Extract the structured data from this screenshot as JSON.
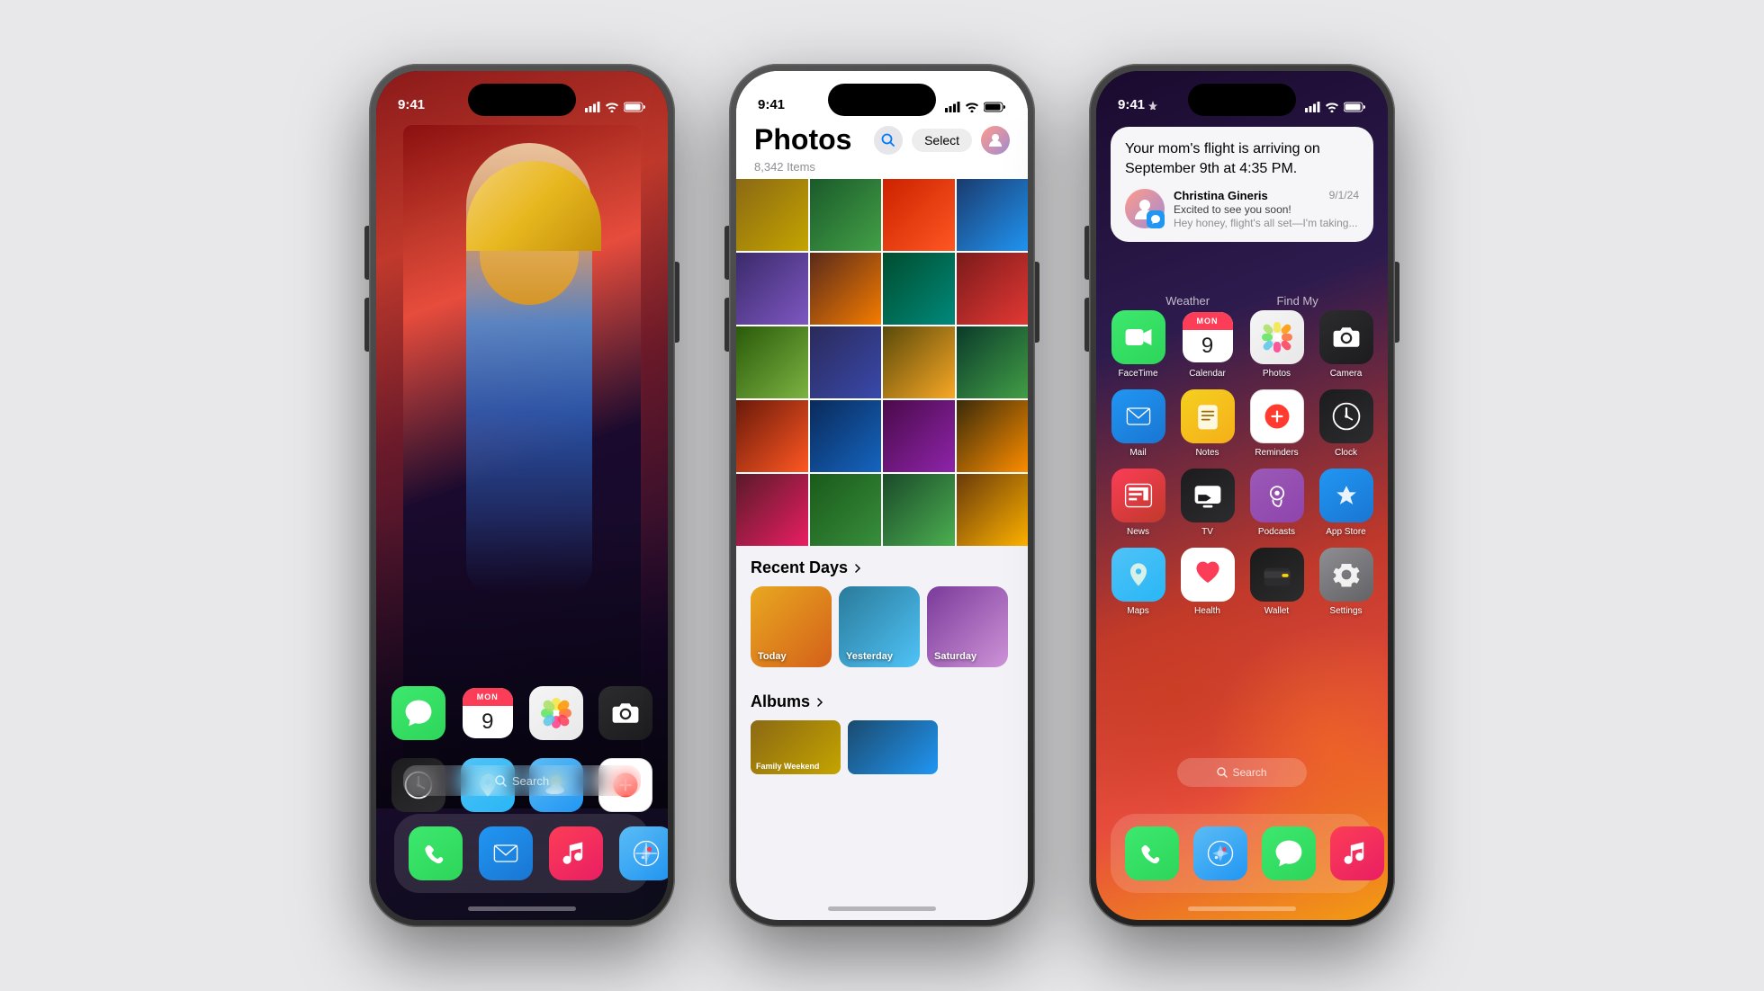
{
  "background": "#e8e8ea",
  "phones": [
    {
      "id": "phone1",
      "label": "iPhone Home Screen",
      "status_time": "9:41",
      "apps_main": [
        {
          "id": "messages",
          "label": "Messages",
          "color_class": "app-messages"
        },
        {
          "id": "calendar",
          "label": "Calendar",
          "color_class": "app-calendar"
        },
        {
          "id": "photos",
          "label": "Photos",
          "color_class": "app-photos"
        },
        {
          "id": "camera",
          "label": "Camera",
          "color_class": "app-camera"
        },
        {
          "id": "clock",
          "label": "Clock",
          "color_class": "app-clock"
        },
        {
          "id": "maps",
          "label": "Maps",
          "color_class": "app-maps"
        },
        {
          "id": "weather",
          "label": "Weather",
          "color_class": "app-weather"
        },
        {
          "id": "reminders",
          "label": "Reminders",
          "color_class": "app-reminders"
        }
      ],
      "dock": [
        {
          "id": "phone",
          "label": "Phone",
          "color_class": "app-phone"
        },
        {
          "id": "mail",
          "label": "Mail",
          "color_class": "app-mail"
        },
        {
          "id": "music",
          "label": "Music",
          "color_class": "app-music"
        },
        {
          "id": "safari",
          "label": "Safari",
          "color_class": "app-safari"
        }
      ],
      "search_placeholder": "Search",
      "calendar_day": "9",
      "calendar_month": "MON"
    },
    {
      "id": "phone2",
      "label": "Photos App",
      "status_time": "9:41",
      "app_title": "Photos",
      "items_count": "8,342 Items",
      "select_label": "Select",
      "recent_days_title": "Recent Days",
      "albums_title": "Albums",
      "days": [
        {
          "label": "Today",
          "color": "#e8a820"
        },
        {
          "label": "Yesterday",
          "color": "#2a6e8a"
        },
        {
          "label": "Saturday",
          "color": "#6a2a8a"
        }
      ]
    },
    {
      "id": "phone3",
      "label": "iPhone Home with Siri Notification",
      "status_time": "9:41",
      "notification": {
        "main_text": "Your mom's flight is arriving on September 9th at 4:35 PM.",
        "contact_name": "Christina Gineris",
        "contact_date": "9/1/24",
        "message_preview": "Excited to see you soon!",
        "message_sub": "Hey honey, flight's all set—I'm taking..."
      },
      "widget_labels": [
        "Weather",
        "Find My"
      ],
      "apps": [
        {
          "id": "facetime",
          "label": "FaceTime",
          "color_class": "app-facetime"
        },
        {
          "id": "calendar",
          "label": "Calendar",
          "color_class": "app-calendar"
        },
        {
          "id": "photos",
          "label": "Photos",
          "color_class": "app-photos"
        },
        {
          "id": "camera",
          "label": "Camera",
          "color_class": "app-camera"
        },
        {
          "id": "mail",
          "label": "Mail",
          "color_class": "app-mail"
        },
        {
          "id": "notes",
          "label": "Notes",
          "color_class": "app-notes"
        },
        {
          "id": "reminders",
          "label": "Reminders",
          "color_class": "app-reminders"
        },
        {
          "id": "clock",
          "label": "Clock",
          "color_class": "app-clock"
        },
        {
          "id": "news",
          "label": "News",
          "color_class": "app-news"
        },
        {
          "id": "tv",
          "label": "TV",
          "color_class": "app-tv"
        },
        {
          "id": "podcasts",
          "label": "Podcasts",
          "color_class": "app-podcasts"
        },
        {
          "id": "appstore",
          "label": "App Store",
          "color_class": "app-appstore"
        },
        {
          "id": "maps",
          "label": "Maps",
          "color_class": "app-maps"
        },
        {
          "id": "health",
          "label": "Health",
          "color_class": "app-health"
        },
        {
          "id": "wallet",
          "label": "Wallet",
          "color_class": "app-wallet"
        },
        {
          "id": "settings",
          "label": "Settings",
          "color_class": "app-settings"
        }
      ],
      "search_label": "Search",
      "dock": [
        {
          "id": "phone",
          "label": "Phone",
          "color_class": "app-phone"
        },
        {
          "id": "safari",
          "label": "Safari",
          "color_class": "app-safari"
        },
        {
          "id": "messages",
          "label": "Messages",
          "color_class": "app-messages"
        },
        {
          "id": "music",
          "label": "Music",
          "color_class": "app-music"
        }
      ],
      "calendar_day": "9",
      "calendar_month": "MON"
    }
  ]
}
